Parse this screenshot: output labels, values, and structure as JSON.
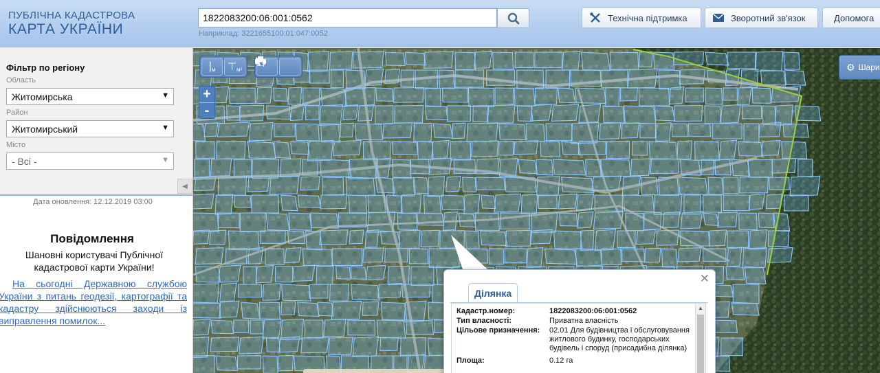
{
  "header": {
    "logo_line1": "ПУБЛІЧНА КАДАСТРОВА",
    "logo_line2": "КАРТА УКРАЇНИ",
    "search_value": "1822083200:06:001:0562",
    "search_hint": "Наприклад: 3221655100:01:047:0052",
    "buttons": {
      "support": "Технічна підтримка",
      "feedback": "Зворотний зв'язок",
      "help": "Допомога"
    },
    "icons": {
      "search": "search-icon",
      "support": "tools-icon",
      "feedback": "mail-icon"
    }
  },
  "sidebar": {
    "filter_title": "Фільтр по регіону",
    "oblast_label": "Область",
    "oblast_value": "Житомирська",
    "rayon_label": "Район",
    "rayon_value": "Житомирський",
    "misto_label": "Місто",
    "misto_value": "- Всі -",
    "update_date": "Дата оновлення: 12.12.2019 03:00",
    "notice_title": "Повідомлення",
    "notice_greeting": "Шановні користувачі Публічної кадастрової карти України!",
    "notice_link": "На сьогодні Державною службою України з питань геодезії, картографії та кадастру здійснюються заходи із виправлення помилок..."
  },
  "map": {
    "tools": {
      "measure_length_label": "м",
      "measure_area_label": "м²"
    },
    "zoom_in": "+",
    "zoom_out": "-",
    "layers_label": "Шари",
    "colors": {
      "parcel_stroke": "#8fc9ff",
      "boundary_green": "#9ad13a"
    }
  },
  "popup": {
    "tab_label": "Ділянка",
    "rows": [
      {
        "key": "Кадастр.номер:",
        "value": "1822083200:06:001:0562",
        "bold": true
      },
      {
        "key": "Тип власності:",
        "value": "Приватна власність",
        "bold": false
      },
      {
        "key": "Цільове призначення:",
        "value": "02.01 Для будівництва і обслуговування житлового будинку, господарських будівель і споруд (присадибна ділянка)",
        "bold": false
      },
      {
        "key": "Площа:",
        "value": "0.12 га",
        "bold": false
      }
    ]
  }
}
